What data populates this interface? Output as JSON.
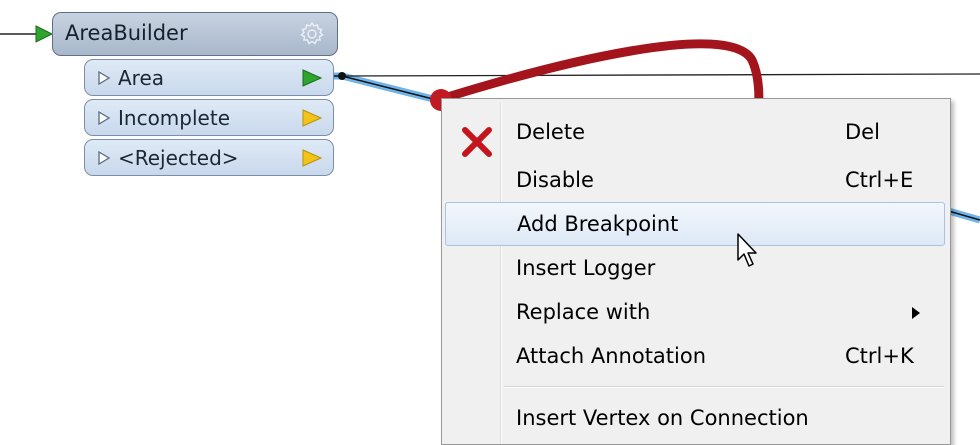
{
  "transformer": {
    "title": "AreaBuilder",
    "ports": [
      {
        "label": "Area"
      },
      {
        "label": "Incomplete"
      },
      {
        "label": "<Rejected>"
      }
    ]
  },
  "context_menu": {
    "items": [
      {
        "label": "Delete",
        "shortcut": "Del",
        "icon": "delete-x-icon"
      },
      {
        "label": "Disable",
        "shortcut": "Ctrl+E"
      },
      {
        "label": "Add Breakpoint",
        "shortcut": "",
        "hovered": true
      },
      {
        "label": "Insert Logger",
        "shortcut": ""
      },
      {
        "label": "Replace with",
        "shortcut": "",
        "submenu": true
      },
      {
        "label": "Attach Annotation",
        "shortcut": "Ctrl+K"
      },
      {
        "label": "Insert Vertex on Connection",
        "shortcut": ""
      }
    ]
  },
  "colors": {
    "connection_highlight": "#6fb3e8",
    "annotation_arrow": "#a3141c",
    "input_port_green": "#2fa52f",
    "output_port_yellow": "#f2c318",
    "delete_icon_red": "#c5151c"
  }
}
